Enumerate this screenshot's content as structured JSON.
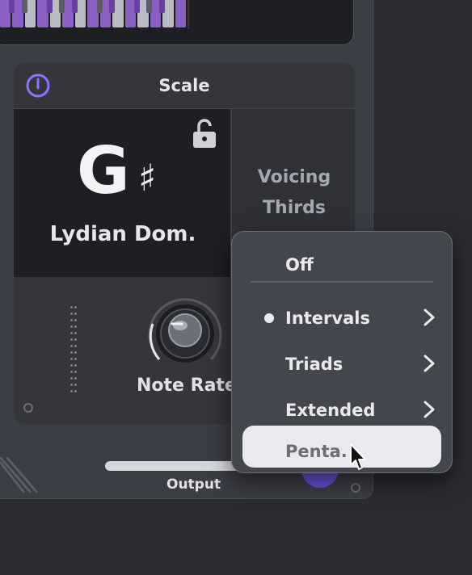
{
  "scale_panel": {
    "title": "Scale",
    "key_note": "G",
    "key_accidental": "♯",
    "scale_name": "Lydian Dom.",
    "voicing_label": "Voicing",
    "voicing_value": "Thirds"
  },
  "controls": {
    "note_rate_label": "Note Rate",
    "output_label": "Output"
  },
  "voicing_menu": {
    "items": [
      {
        "label": "Off",
        "has_submenu": false,
        "checked": false
      },
      {
        "label": "Intervals",
        "has_submenu": true,
        "checked": true
      },
      {
        "label": "Triads",
        "has_submenu": true,
        "checked": false
      },
      {
        "label": "Extended",
        "has_submenu": true,
        "checked": false
      },
      {
        "label": "Penta.",
        "has_submenu": false,
        "checked": false,
        "hovered": true
      }
    ]
  },
  "colors": {
    "accent_purple": "#8c5fc2",
    "power_icon": "#8a74ff",
    "menu_highlight": "#e9eaed"
  }
}
